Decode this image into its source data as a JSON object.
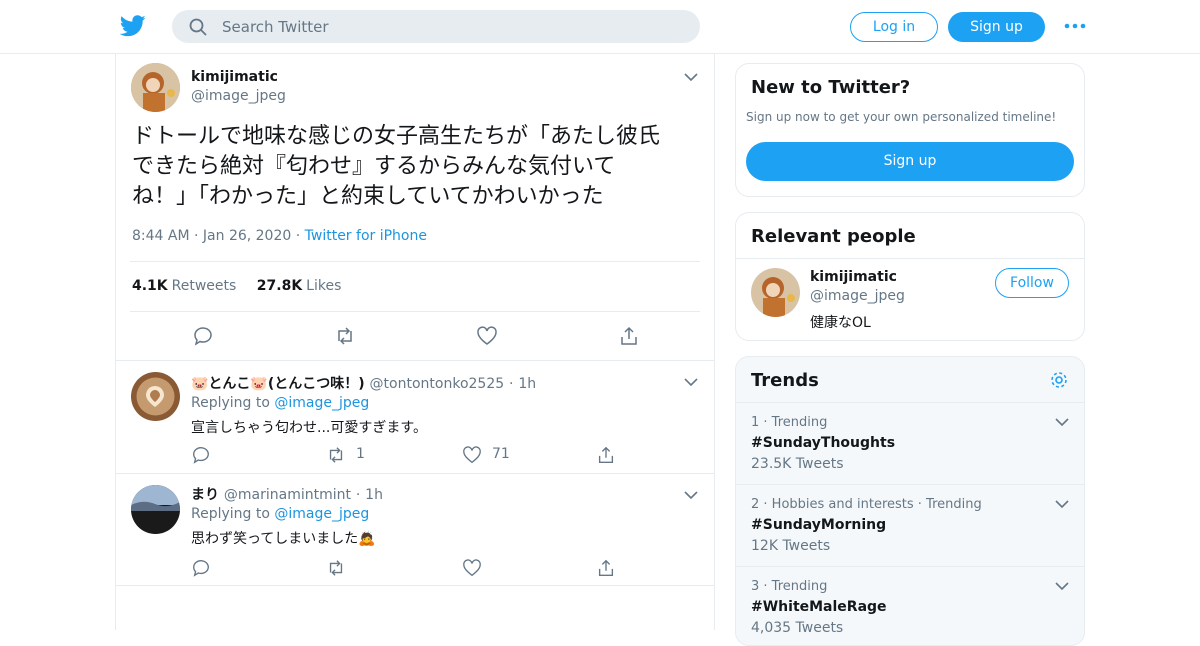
{
  "colors": {
    "brand": "#1da1f2",
    "link": "#1b95e0",
    "muted": "#657786",
    "border": "#e6ecf0"
  },
  "header": {
    "logo_icon": "twitter-bird-icon",
    "search_placeholder": "Search Twitter",
    "login_label": "Log in",
    "signup_label": "Sign up",
    "more_icon": "more-dots-icon"
  },
  "tweet": {
    "author_name": "kimijimatic",
    "author_handle": "@image_jpeg",
    "text_lines": [
      "ドトールで地味な感じの女子高生たちが「あたし彼氏",
      "できたら絶対『匂わせ』するからみんな気付いて",
      "ね！」「わかった」と約束していてかわいかった"
    ],
    "time": "8:44 AM",
    "date": "Jan 26, 2020",
    "source": "Twitter for iPhone",
    "sep": "·",
    "retweets_count": "4.1K",
    "retweets_label": "Retweets",
    "likes_count": "27.8K",
    "likes_label": "Likes"
  },
  "replies": [
    {
      "name": "🐷とんこ🐷(とんこつ味！)",
      "handle": "@tontontonko2525",
      "time": "1h",
      "replying_prefix": "Replying to",
      "replying_to": "@image_jpeg",
      "text": "宣言しちゃう匂わせ...可愛すぎます。",
      "retweets": "1",
      "likes": "71"
    },
    {
      "name": "まり",
      "handle": "@marinamintmint",
      "time": "1h",
      "replying_prefix": "Replying to",
      "replying_to": "@image_jpeg",
      "text": "思わず笑ってしまいました🙇",
      "retweets": "",
      "likes": ""
    }
  ],
  "sidebar": {
    "new_to_twitter": {
      "title": "New to Twitter?",
      "subtitle": "Sign up now to get your own personalized timeline!",
      "button": "Sign up"
    },
    "relevant": {
      "title": "Relevant people",
      "name": "kimijimatic",
      "handle": "@image_jpeg",
      "bio": "健康なOL",
      "follow": "Follow"
    },
    "trends": {
      "title": "Trends",
      "items": [
        {
          "meta": "1 · Trending",
          "tag": "#SundayThoughts",
          "count": "23.5K Tweets"
        },
        {
          "meta": "2 · Hobbies and interests · Trending",
          "tag": "#SundayMorning",
          "count": "12K Tweets"
        },
        {
          "meta": "3 · Trending",
          "tag": "#WhiteMaleRage",
          "count": "4,035 Tweets"
        }
      ]
    }
  }
}
